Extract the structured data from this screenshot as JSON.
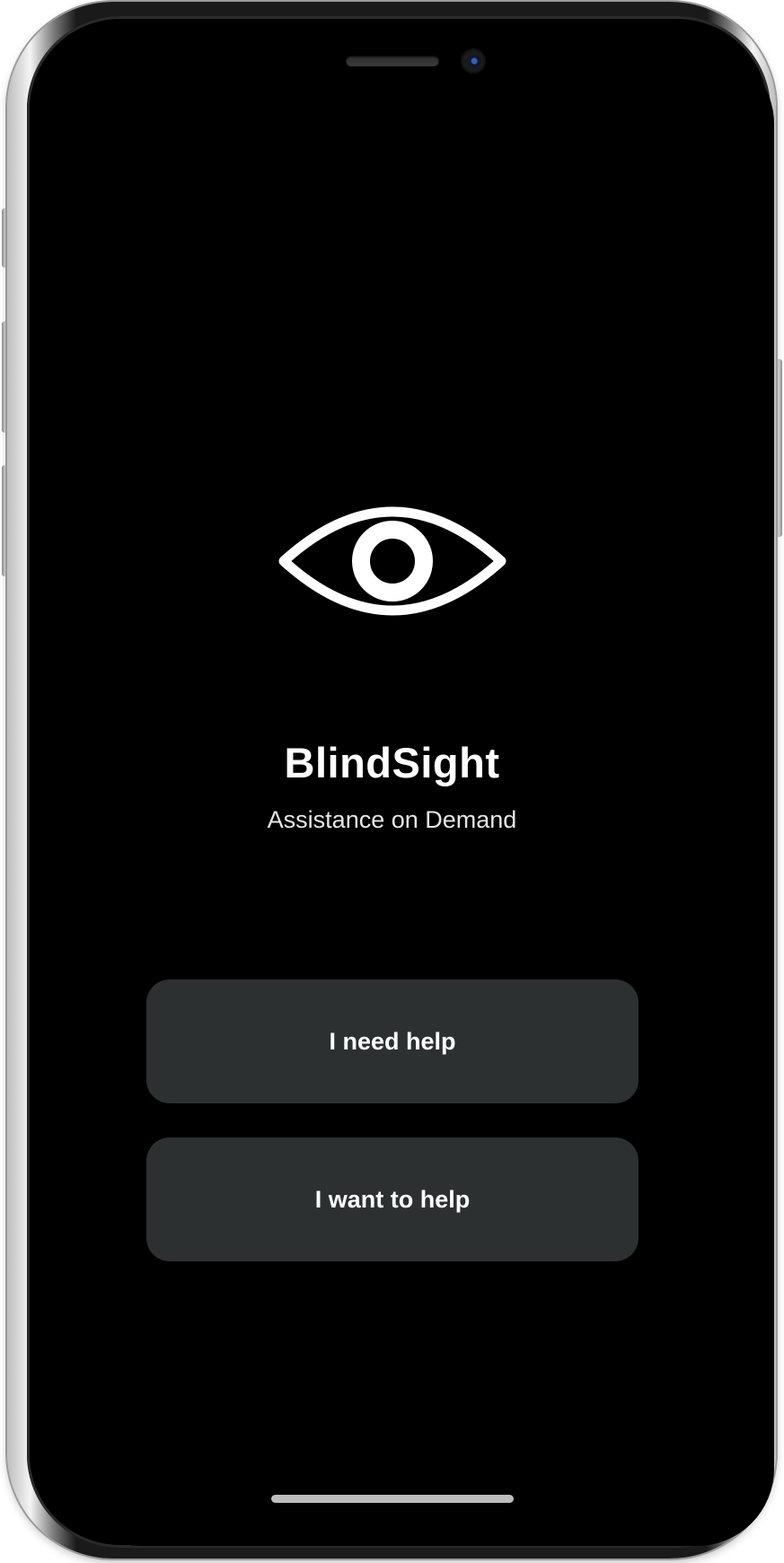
{
  "app": {
    "title": "BlindSight",
    "subtitle": "Assistance on Demand",
    "logo_icon": "eye-icon"
  },
  "actions": {
    "need_help_label": "I need help",
    "want_to_help_label": "I want to help"
  },
  "colors": {
    "background": "#000000",
    "button_background": "#2d3031",
    "text": "#ffffff"
  }
}
